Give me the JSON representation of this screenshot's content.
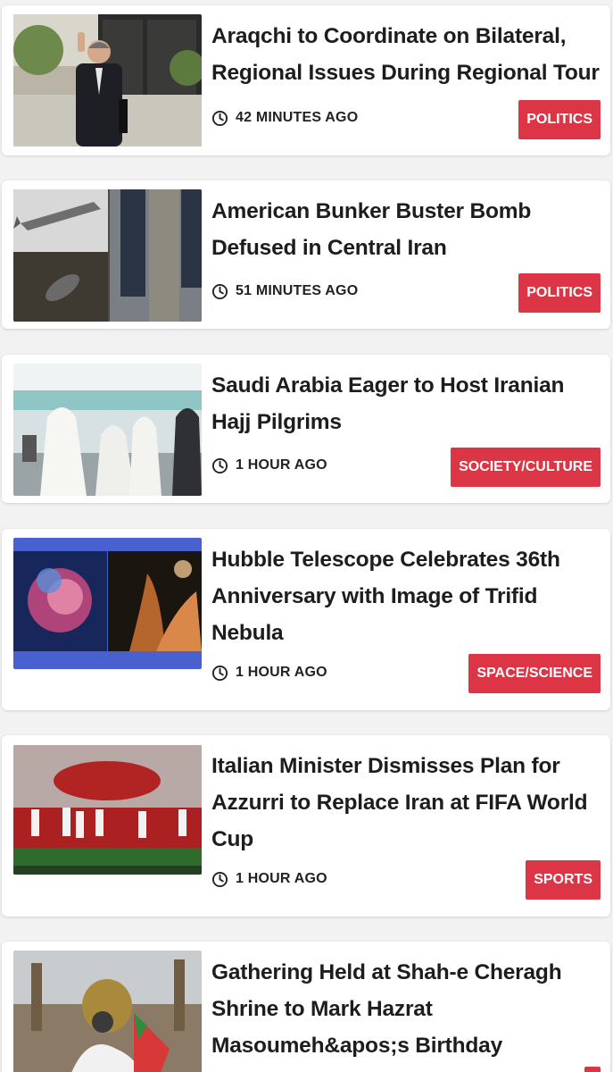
{
  "articles": [
    {
      "title": "Araqchi to Coordinate on Bilateral, Regional Issues During Regional Tour",
      "time": "42 MINUTES AGO",
      "category": "POLITICS",
      "thumbnail_icon": "diplomat-waving-photo"
    },
    {
      "title": "American Bunker Buster Bomb Defused in Central Iran",
      "time": "51 MINUTES AGO",
      "category": "POLITICS",
      "thumbnail_icon": "bomb-collage-photo"
    },
    {
      "title": "Saudi Arabia Eager to Host Iranian Hajj Pilgrims",
      "time": "1 HOUR AGO",
      "category": "SOCIETY/CULTURE",
      "thumbnail_icon": "pilgrims-airport-photo"
    },
    {
      "title": "Hubble Telescope Celebrates 36th Anniversary with Image of Trifid Nebula",
      "time": "1 HOUR AGO",
      "category": "SPACE/SCIENCE",
      "thumbnail_icon": "nebula-photo"
    },
    {
      "title": "Italian Minister Dismisses Plan for Azzurri to Replace Iran at FIFA World Cup",
      "time": "1 HOUR AGO",
      "category": "SPORTS",
      "thumbnail_icon": "football-team-photo"
    },
    {
      "title": "Gathering Held at Shah-e Cheragh Shrine to Mark Hazrat Masoumeh&apos;s Birthday",
      "time": "",
      "category": "",
      "thumbnail_icon": "shrine-gathering-photo"
    }
  ],
  "colors": {
    "badge": "#dc3545",
    "title": "#1d1d1f",
    "background": "#f2f2f3"
  }
}
